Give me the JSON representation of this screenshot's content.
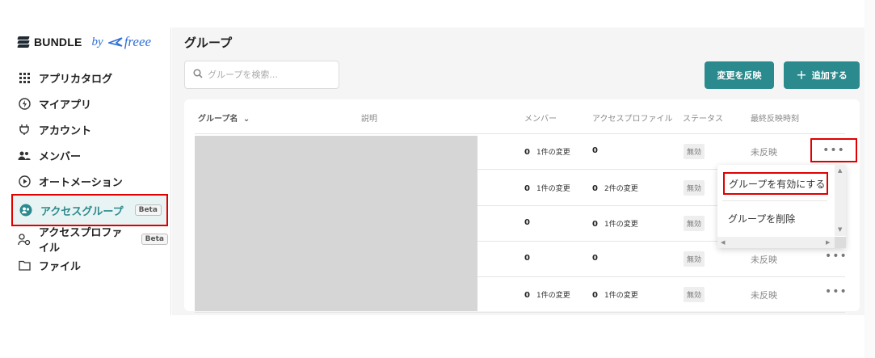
{
  "brand": {
    "name": "BUNDLE",
    "by": "by",
    "partner": "freee"
  },
  "sidebar": {
    "items": [
      {
        "label": "アプリカタログ",
        "icon": "grid-icon"
      },
      {
        "label": "マイアプリ",
        "icon": "bolt-circle-icon"
      },
      {
        "label": "アカウント",
        "icon": "plug-icon"
      },
      {
        "label": "メンバー",
        "icon": "people-icon"
      },
      {
        "label": "オートメーション",
        "icon": "play-circle-icon"
      },
      {
        "label": "アクセスグループ",
        "icon": "group-circle-icon",
        "badge": "Beta",
        "active": true
      },
      {
        "label": "アクセスプロファイル",
        "icon": "user-settings-icon",
        "badge": "Beta"
      },
      {
        "label": "ファイル",
        "icon": "folder-icon"
      }
    ]
  },
  "main": {
    "title": "グループ",
    "search_placeholder": "グループを検索...",
    "apply_button": "変更を反映",
    "add_button": "追加する",
    "columns": {
      "name": "グループ名",
      "description": "説明",
      "members": "メンバー",
      "access_profile": "アクセスプロファイル",
      "status": "ステータス",
      "last_sync": "最終反映時刻"
    },
    "rows": [
      {
        "members": "0",
        "members_change": "1件の変更",
        "profiles": "0",
        "profiles_change": "",
        "status": "無効",
        "last_sync": "未反映"
      },
      {
        "members": "0",
        "members_change": "1件の変更",
        "profiles": "0",
        "profiles_change": "2件の変更",
        "status": "無効",
        "last_sync": ""
      },
      {
        "members": "0",
        "members_change": "",
        "profiles": "0",
        "profiles_change": "1件の変更",
        "status": "無効",
        "last_sync": ""
      },
      {
        "members": "0",
        "members_change": "",
        "profiles": "0",
        "profiles_change": "",
        "status": "無効",
        "last_sync": "未反映"
      },
      {
        "members": "0",
        "members_change": "1件の変更",
        "profiles": "0",
        "profiles_change": "1件の変更",
        "status": "無効",
        "last_sync": "未反映"
      }
    ]
  },
  "menu": {
    "enable": "グループを有効にする",
    "delete": "グループを削除"
  },
  "colors": {
    "accent": "#2b8a8d",
    "highlight": "#e00000",
    "active_bg": "#e8f3f3"
  }
}
